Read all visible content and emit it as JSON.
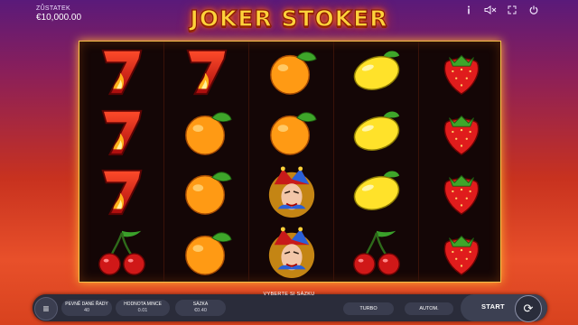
{
  "header": {
    "balance_label": "ZŮSTATEK",
    "balance_value": "€10,000.00",
    "logo_text": "JOKER STOKER",
    "icons": [
      "info-icon",
      "mute-icon",
      "fullscreen-icon",
      "power-icon"
    ]
  },
  "reels": [
    [
      "seven",
      "seven",
      "seven",
      "cherry"
    ],
    [
      "seven",
      "orange",
      "orange",
      "orange"
    ],
    [
      "orange",
      "orange",
      "joker",
      "joker"
    ],
    [
      "lemon",
      "lemon",
      "lemon",
      "cherry"
    ],
    [
      "strawberry",
      "strawberry",
      "strawberry",
      "strawberry"
    ]
  ],
  "bottom": {
    "status_message": "VYBERTE SI SÁZKU",
    "fixed_lines_label": "PEVNĚ DANÉ ŘADY",
    "fixed_lines_value": "40",
    "coin_value_label": "HODNOTA MINCE",
    "coin_value": "0.01",
    "bet_label": "SÁZKA",
    "bet_value": "€0.40",
    "turbo_label": "TURBO",
    "autoplay_label": "AUTOM.",
    "start_label": "START"
  },
  "colors": {
    "frame": "#f6c04a",
    "bar": "#2a2c3a",
    "logo": "#ffd23a"
  }
}
